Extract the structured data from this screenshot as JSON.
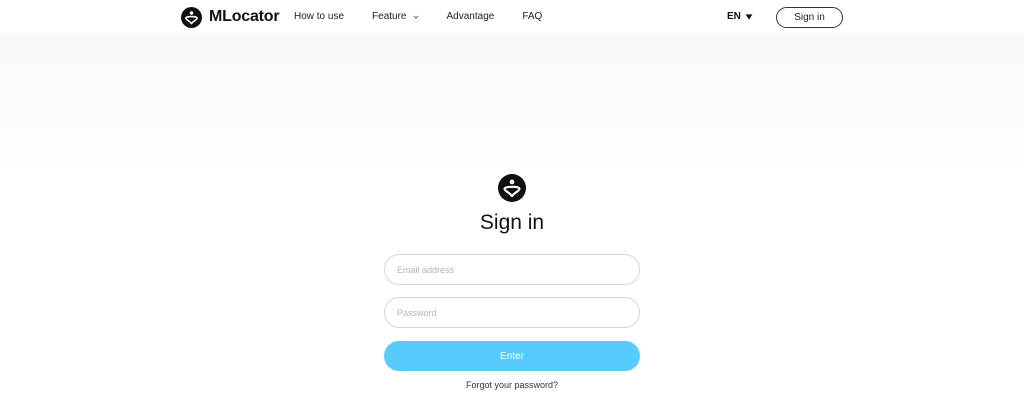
{
  "header": {
    "brand_name": "MLocator",
    "brand_logo_icon": "mlocator-logo-icon",
    "nav": [
      {
        "label": "How to use"
      },
      {
        "label": "Feature",
        "icon": "chevron-down-icon"
      },
      {
        "label": "Advantage"
      },
      {
        "label": "FAQ"
      }
    ],
    "language": "EN",
    "language_icon": "caret-down-icon",
    "signin_label": "Sign in"
  },
  "auth": {
    "logo_icon": "mlocator-logo-icon",
    "title": "Sign in",
    "email_placeholder": "Email address",
    "email_value": "",
    "password_placeholder": "Password",
    "password_value": "",
    "enter_label": "Enter",
    "forgot_label": "Forgot your password?"
  },
  "colors": {
    "accent": "#57cbfb",
    "text": "#111111",
    "border": "#d6d6d6"
  }
}
